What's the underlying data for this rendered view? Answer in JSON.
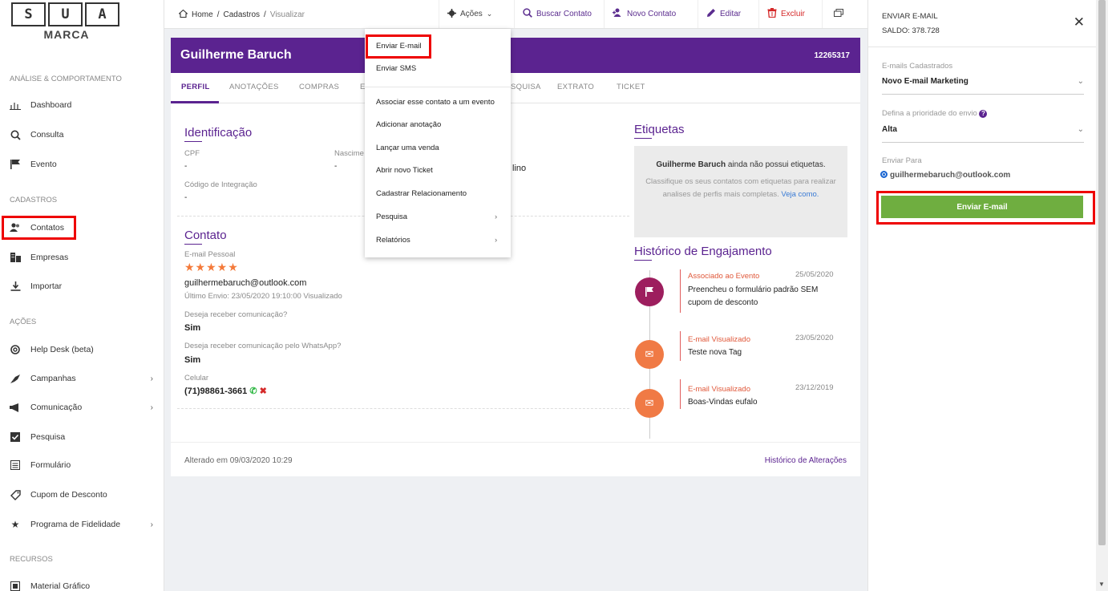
{
  "logo": {
    "letters": [
      "S",
      "U",
      "A"
    ],
    "text": "MARCA"
  },
  "sidebar": {
    "sections": {
      "analise": "ANÁLISE & COMPORTAMENTO",
      "cadastros": "CADASTROS",
      "acoes": "AÇÕES",
      "recursos": "RECURSOS"
    },
    "items": [
      {
        "label": "Dashboard",
        "icon": "chart-icon"
      },
      {
        "label": "Consulta",
        "icon": "search-icon"
      },
      {
        "label": "Evento",
        "icon": "flag-icon"
      },
      {
        "label": "Contatos",
        "icon": "users-icon"
      },
      {
        "label": "Empresas",
        "icon": "building-icon"
      },
      {
        "label": "Importar",
        "icon": "download-icon"
      },
      {
        "label": "Help Desk (beta)",
        "icon": "lifebuoy-icon"
      },
      {
        "label": "Campanhas",
        "icon": "rocket-icon"
      },
      {
        "label": "Comunicação",
        "icon": "megaphone-icon"
      },
      {
        "label": "Pesquisa",
        "icon": "checkbox-icon"
      },
      {
        "label": "Formulário",
        "icon": "form-icon"
      },
      {
        "label": "Cupom de Desconto",
        "icon": "tag-icon"
      },
      {
        "label": "Programa de Fidelidade",
        "icon": "star-icon"
      },
      {
        "label": "Material Gráfico",
        "icon": "image-icon"
      }
    ]
  },
  "topbar": {
    "breadcrumb": {
      "home": "Home",
      "sep": "/",
      "cadastros": "Cadastros",
      "current": "Visualizar"
    },
    "acoes": "Ações",
    "buscar": "Buscar Contato",
    "novo": "Novo Contato",
    "editar": "Editar",
    "excluir": "Excluir"
  },
  "dropdown": {
    "items": [
      "Enviar E-mail",
      "Enviar SMS",
      "Associar esse contato a um evento",
      "Adicionar anotação",
      "Lançar uma venda",
      "Abrir novo Ticket",
      "Cadastrar Relacionamento",
      "Pesquisa",
      "Relatórios"
    ]
  },
  "contact": {
    "name": "Guilherme Baruch",
    "id": "12265317",
    "tabs": [
      "PERFIL",
      "ANOTAÇÕES",
      "COMPRAS",
      "E",
      "SQUISA",
      "EXTRATO",
      "TICKET"
    ],
    "identificacao": {
      "title": "Identificação",
      "cpf_label": "CPF",
      "cpf_value": "-",
      "nasc_label": "Nascime",
      "nasc_value": "-",
      "sexo_value": "lino",
      "codigo_label": "Código de Integração",
      "codigo_value": "-"
    },
    "contato": {
      "title": "Contato",
      "email_label": "E-mail Pessoal",
      "stars": "★★★★★",
      "email": "guilhermebaruch@outlook.com",
      "ultimo_envio": "Último Envio: 23/05/2020 19:10:00 Visualizado",
      "comunicacao_label": "Deseja receber comunicação?",
      "comunicacao_value": "Sim",
      "whatsapp_label": "Deseja receber comunicação pelo WhatsApp?",
      "whatsapp_value": "Sim",
      "celular_label": "Celular",
      "celular_value": "(71)98861-3661"
    },
    "etiquetas": {
      "title": "Etiquetas",
      "name_bold": "Guilherme Baruch",
      "msg": " ainda não possui etiquetas.",
      "desc": "Classifique os seus contatos com etiquetas para realizar analises de perfis mais completas.",
      "link": "Veja como."
    },
    "historico": {
      "title": "Histórico de Engajamento",
      "events": [
        {
          "label": "Associado ao Evento",
          "date": "25/05/2020",
          "text": "Preencheu o formulário padrão SEM cupom de desconto"
        },
        {
          "label": "E-mail Visualizado",
          "date": "23/05/2020",
          "text": "Teste nova Tag"
        },
        {
          "label": "E-mail Visualizado",
          "date": "23/12/2019",
          "text": "Boas-Vindas eufalo"
        }
      ]
    },
    "footer": {
      "alterado": "Alterado em 09/03/2020 10:29",
      "historico": "Histórico de Alterações"
    }
  },
  "panel": {
    "title": "ENVIAR E-MAIL",
    "saldo": "SALDO: 378.728",
    "emails_label": "E-mails Cadastrados",
    "emails_value": "Novo E-mail Marketing",
    "prioridade_label": "Defina a prioridade do envio",
    "prioridade_value": "Alta",
    "enviar_para_label": "Enviar Para",
    "enviar_para_value": "guilhermebaruch@outlook.com",
    "button": "Enviar E-mail"
  }
}
